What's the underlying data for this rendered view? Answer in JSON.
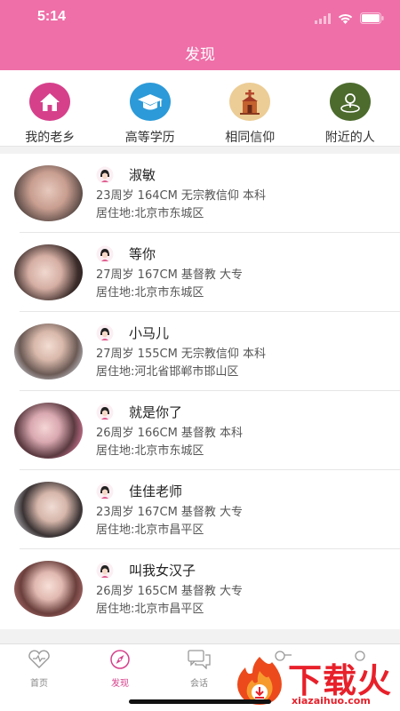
{
  "status_bar": {
    "time": "5:14"
  },
  "header": {
    "title": "发现"
  },
  "categories": [
    {
      "label": "我的老乡",
      "icon": "home-icon",
      "color": "#d6408b"
    },
    {
      "label": "高等学历",
      "icon": "graduation-cap-icon",
      "color": "#2c9ad8"
    },
    {
      "label": "相同信仰",
      "icon": "church-icon",
      "color": "#e9c58a"
    },
    {
      "label": "附近的人",
      "icon": "location-person-icon",
      "color": "#4c6b2d"
    }
  ],
  "users": [
    {
      "name": "淑敏",
      "info": "23周岁 164CM 无宗教信仰 本科",
      "address": "居住地:北京市东城区"
    },
    {
      "name": "等你",
      "info": "27周岁 167CM 基督教 大专",
      "address": "居住地:北京市东城区"
    },
    {
      "name": "小马儿",
      "info": "27周岁 155CM 无宗教信仰 本科",
      "address": "居住地:河北省邯郸市邯山区"
    },
    {
      "name": "就是你了",
      "info": "26周岁 166CM 基督教 本科",
      "address": "居住地:北京市东城区"
    },
    {
      "name": "佳佳老师",
      "info": "23周岁 167CM 基督教 大专",
      "address": "居住地:北京市昌平区"
    },
    {
      "name": "叫我女汉子",
      "info": "26周岁 165CM 基督教 大专",
      "address": "居住地:北京市昌平区"
    }
  ],
  "tabbar": {
    "tabs": [
      {
        "label": "首页",
        "icon": "heart-icon"
      },
      {
        "label": "发现",
        "icon": "compass-icon"
      },
      {
        "label": "会话",
        "icon": "chat-icon"
      }
    ],
    "active": "发现"
  },
  "watermark": {
    "main": "下载火",
    "sub": "xiazaihuo.com"
  },
  "colors": {
    "header": "#ef6fa8",
    "active_tab": "#d6408b"
  }
}
